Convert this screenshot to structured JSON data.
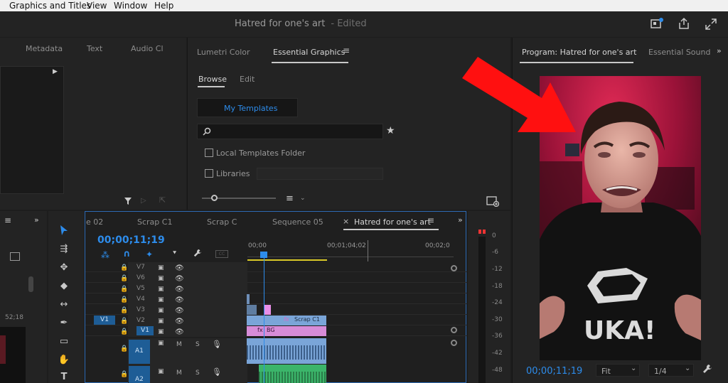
{
  "menu": [
    "Graphics and Titles",
    "View",
    "Window",
    "Help"
  ],
  "window_title": "Hatred for one's art",
  "window_status": "- Edited",
  "left_panel": {
    "tabs": [
      "Metadata",
      "Text",
      "Audio Cl"
    ]
  },
  "essential_graphics": {
    "tabs": [
      "Lumetri Color",
      "Essential Graphics"
    ],
    "subtabs": [
      "Browse",
      "Edit"
    ],
    "template_button": "My Templates",
    "search_placeholder": "",
    "options": [
      "Local Templates Folder",
      "Libraries"
    ]
  },
  "program_monitor": {
    "tabs": [
      "Program: Hatred for one's art",
      "Essential Sound"
    ],
    "timecode": "00;00;11;19",
    "fit_label": "Fit",
    "resolution": "1/4"
  },
  "project_panel": {
    "duration": "52;18"
  },
  "timeline": {
    "tabs": [
      "e 02",
      "Scrap C1",
      "Scrap C",
      "Sequence 05",
      "Hatred for one's art"
    ],
    "timecode": "00;00;11;19",
    "ruler": [
      "00;00",
      "00;01;04;02",
      "00;02;0"
    ],
    "video_tracks": [
      "V7",
      "V6",
      "V5",
      "V4",
      "V3",
      "V2",
      "V1"
    ],
    "audio_tracks": [
      "A1",
      "A2"
    ],
    "source_patch": "V1",
    "audio_controls": [
      "M",
      "S"
    ],
    "clips": {
      "scrap": "Scrap C1",
      "bg": "BG",
      "fx": "fx"
    }
  },
  "meter_labels": [
    "0",
    "-6",
    "-12",
    "-18",
    "-24",
    "-30",
    "-36",
    "-42",
    "-48"
  ],
  "colors": {
    "accent": "#2d8ceb",
    "arrow": "#ff1010",
    "clip_pink": "#d78cd8",
    "clip_blue": "#7aa5d8",
    "clip_green": "#3bb56a"
  }
}
